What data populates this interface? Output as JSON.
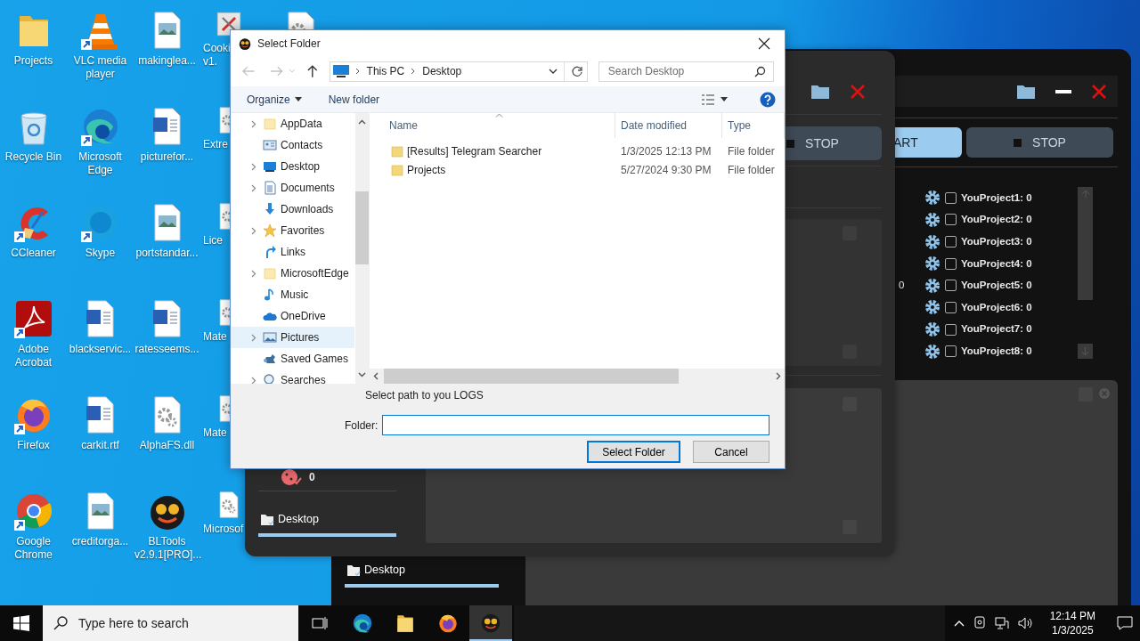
{
  "desktop": {
    "icons": [
      {
        "label": "Projects",
        "kind": "folder",
        "shortcut": false
      },
      {
        "label": "Recycle Bin",
        "kind": "recycle",
        "shortcut": false
      },
      {
        "label": "CCleaner",
        "kind": "cleaner",
        "shortcut": true
      },
      {
        "label": "Adobe Acrobat",
        "kind": "pdf",
        "shortcut": true
      },
      {
        "label": "Firefox",
        "kind": "firefox",
        "shortcut": true
      },
      {
        "label": "Google Chrome",
        "kind": "chrome",
        "shortcut": true
      },
      {
        "label": "VLC media player",
        "kind": "cone",
        "shortcut": true
      },
      {
        "label": "Microsoft Edge",
        "kind": "edge",
        "shortcut": true
      },
      {
        "label": "Skype",
        "kind": "chat",
        "shortcut": true
      },
      {
        "label": "blackservic...",
        "kind": "document",
        "shortcut": false
      },
      {
        "label": "carkit.rtf",
        "kind": "document",
        "shortcut": false
      },
      {
        "label": "creditorga...",
        "kind": "image",
        "shortcut": false
      },
      {
        "label": "makinglea...",
        "kind": "image",
        "shortcut": false
      },
      {
        "label": "picturefor...",
        "kind": "document",
        "shortcut": false
      },
      {
        "label": "portstandar...",
        "kind": "image",
        "shortcut": false
      },
      {
        "label": "ratesseems...",
        "kind": "document",
        "shortcut": false
      },
      {
        "label": "AlphaFS.dll",
        "kind": "gear",
        "shortcut": false
      },
      {
        "label": "BLTools v2.9.1[PRO]...",
        "kind": "emoji",
        "shortcut": false
      },
      {
        "label": "Cooki v1.",
        "kind": "tool",
        "shortcut": false
      },
      {
        "label": "Extre",
        "kind": "gear",
        "shortcut": false
      },
      {
        "label": "Lice",
        "kind": "gear",
        "shortcut": false
      },
      {
        "label": "Mate",
        "kind": "gear",
        "shortcut": false
      },
      {
        "label": "Mate",
        "kind": "gear",
        "shortcut": false
      },
      {
        "label": "Microsof",
        "kind": "gear",
        "shortcut": false
      },
      {
        "kind": "gear"
      }
    ]
  },
  "back_window": {
    "buttons": [
      {
        "label": "ART",
        "kind": "start"
      },
      {
        "label": "STOP",
        "kind": "stop"
      }
    ],
    "projects": [
      {
        "label": "YouProject1: 0",
        "checked": false
      },
      {
        "label": "YouProject2: 0",
        "checked": false
      },
      {
        "label": "YouProject3: 0",
        "checked": false
      },
      {
        "label": "YouProject4: 0",
        "checked": false
      },
      {
        "label": "YouProject5: 0",
        "checked": false,
        "side_value": "0"
      },
      {
        "label": "YouProject6: 0",
        "checked": false
      },
      {
        "label": "YouProject7: 0",
        "checked": false
      },
      {
        "label": "YouProject8: 0",
        "checked": false
      }
    ],
    "sidebar_tab": {
      "label": "Desktop",
      "selected": true
    }
  },
  "front_window": {
    "buttons": [
      {
        "label": "STOP",
        "kind": "stop"
      }
    ],
    "counter": "0",
    "sidebar_tab": {
      "label": "Desktop",
      "selected": true
    }
  },
  "dialog": {
    "title": "Select Folder",
    "address": [
      "This PC",
      "Desktop"
    ],
    "search_placeholder": "Search Desktop",
    "toolbar": [
      {
        "label": "Organize",
        "dropdown": true
      },
      {
        "label": "New folder",
        "dropdown": false
      }
    ],
    "tree": [
      {
        "label": "AppData",
        "kind": "folder",
        "expandable": true,
        "selected": false
      },
      {
        "label": "Contacts",
        "kind": "contacts",
        "expandable": false,
        "selected": false
      },
      {
        "label": "Desktop",
        "kind": "desktop",
        "expandable": true,
        "selected": false
      },
      {
        "label": "Documents",
        "kind": "documents",
        "expandable": true,
        "selected": false
      },
      {
        "label": "Downloads",
        "kind": "downloads",
        "expandable": false,
        "selected": false
      },
      {
        "label": "Favorites",
        "kind": "star",
        "expandable": true,
        "selected": false
      },
      {
        "label": "Links",
        "kind": "links",
        "expandable": false,
        "selected": false
      },
      {
        "label": "MicrosoftEdge",
        "kind": "folder",
        "expandable": true,
        "selected": false
      },
      {
        "label": "Music",
        "kind": "music",
        "expandable": false,
        "selected": false
      },
      {
        "label": "OneDrive",
        "kind": "cloud",
        "expandable": false,
        "selected": false
      },
      {
        "label": "Pictures",
        "kind": "pictures",
        "expandable": true,
        "selected": true
      },
      {
        "label": "Saved Games",
        "kind": "games",
        "expandable": false,
        "selected": false
      },
      {
        "label": "Searches",
        "kind": "search",
        "expandable": true,
        "selected": false
      }
    ],
    "columns": [
      "Name",
      "Date modified",
      "Type"
    ],
    "files": [
      {
        "name": "[Results] Telegram Searcher",
        "date": "1/3/2025 12:13 PM",
        "type": "File folder"
      },
      {
        "name": "Projects",
        "date": "5/27/2024 9:30 PM",
        "type": "File folder"
      }
    ],
    "hint": "Select path to you LOGS",
    "folder_label": "Folder:",
    "buttons": [
      {
        "label": "Select Folder",
        "default": true
      },
      {
        "label": "Cancel",
        "default": false
      }
    ]
  },
  "taskbar": {
    "search_placeholder": "Type here to search",
    "apps": [
      {
        "kind": "edge",
        "active": false
      },
      {
        "kind": "explorer",
        "active": false
      },
      {
        "kind": "firefox",
        "active": false
      },
      {
        "kind": "emoji",
        "active": true
      }
    ],
    "time": "12:14 PM",
    "date": "1/3/2025"
  }
}
